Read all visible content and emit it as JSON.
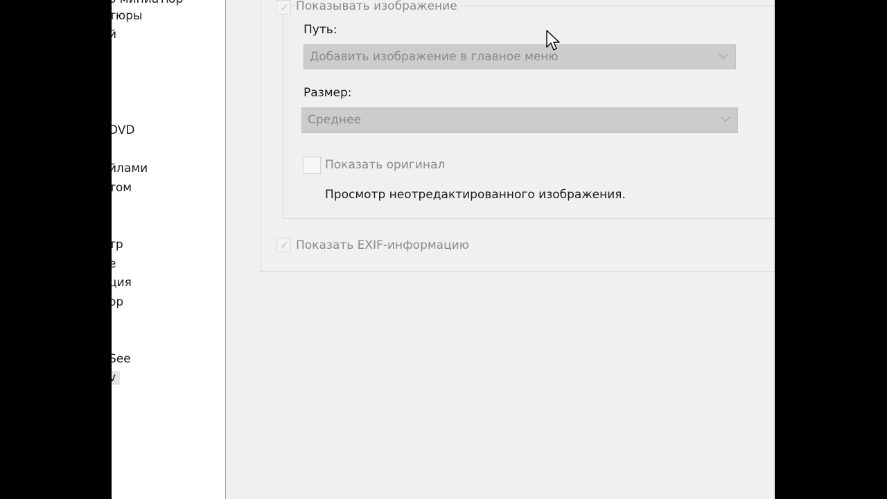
{
  "sidebar": {
    "items": [
      {
        "label": "о миниатюр",
        "selected": false
      },
      {
        "label": "тюры",
        "selected": false
      },
      {
        "label": "й",
        "selected": false
      },
      {
        "label": "DVD",
        "selected": false
      },
      {
        "label": "йлами",
        "selected": false
      },
      {
        "label": "том",
        "selected": false
      },
      {
        "label": "тр",
        "selected": false
      },
      {
        "label": "е",
        "selected": false
      },
      {
        "label": "ция",
        "selected": false
      },
      {
        "label": "ор",
        "selected": false
      },
      {
        "label": "See",
        "selected": false
      },
      {
        "label": "v",
        "selected": true
      }
    ]
  },
  "settings": {
    "show_image": {
      "label": "Показывать изображение",
      "checked": true,
      "enabled": false
    },
    "path": {
      "label": "Путь:",
      "selected": "Добавить изображение в главное меню",
      "enabled": false
    },
    "size": {
      "label": "Размер:",
      "selected": "Среднее",
      "enabled": false
    },
    "show_original": {
      "label": "Показать оригинал",
      "checked": false,
      "enabled": false,
      "description": "Просмотр неотредактированного изображения."
    },
    "show_exif": {
      "label": "Показать EXIF-информацию",
      "checked": true,
      "enabled": false
    }
  },
  "icons": {
    "checkmark": "check-icon",
    "dropdown": "chevron-down-icon",
    "cursor": "mouse-pointer-icon"
  },
  "colors": {
    "window_bg": "#f0f0f0",
    "combo_disabled_bg": "#cccccc",
    "disabled_text": "#8a8a8a",
    "frame_bg": "#000000"
  }
}
